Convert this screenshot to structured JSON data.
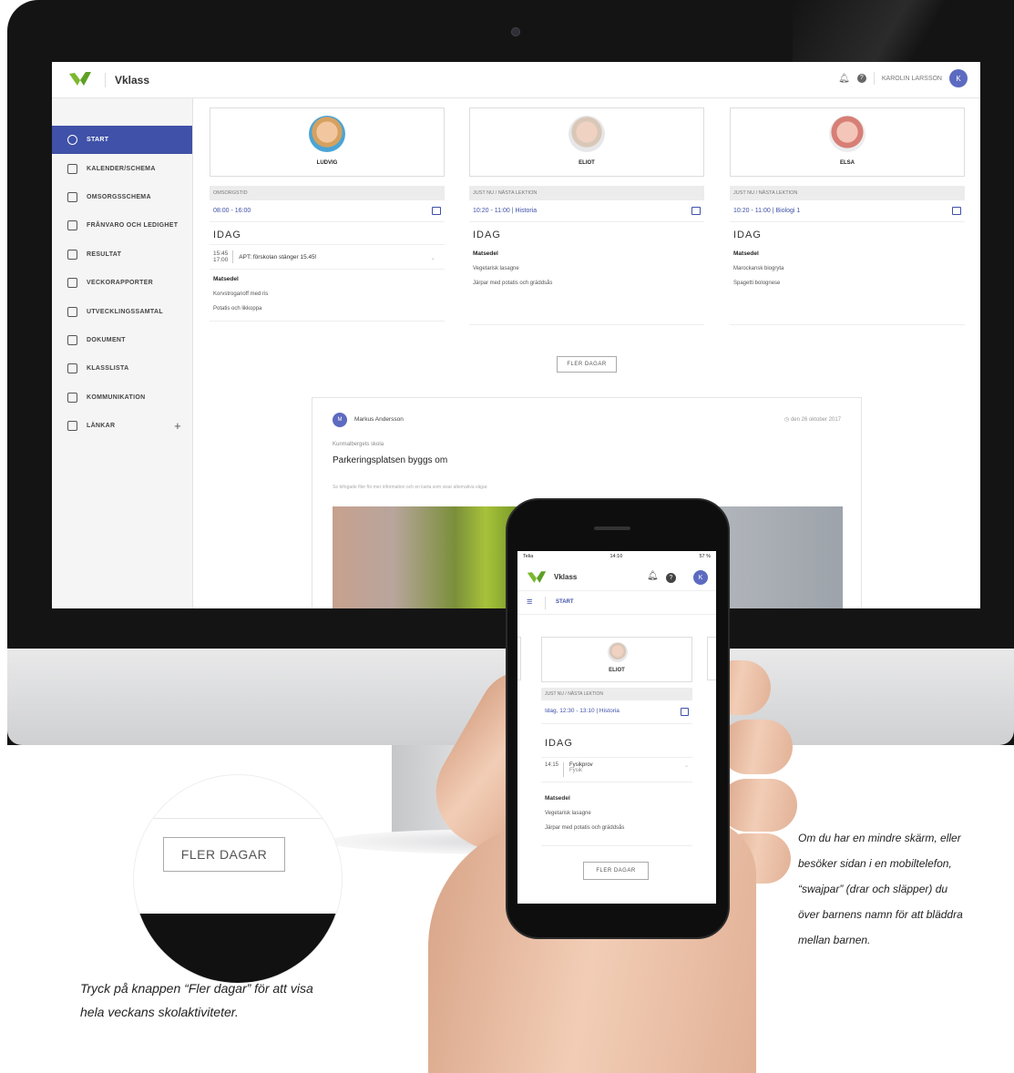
{
  "app": {
    "brand": "Vklass",
    "user_name": "KAROLIN LARSSON",
    "user_initial": "K",
    "accent": "#3f51a8"
  },
  "sidebar": {
    "items": [
      {
        "label": "START",
        "icon": "home-icon",
        "active": true
      },
      {
        "label": "KALENDER/SCHEMA",
        "icon": "calendar-icon"
      },
      {
        "label": "OMSORGSSCHEMA",
        "icon": "calendar-icon"
      },
      {
        "label": "FRÅNVARO OCH LEDIGHET",
        "icon": "calendar-icon"
      },
      {
        "label": "RESULTAT",
        "icon": "grid-icon"
      },
      {
        "label": "VECKORAPPORTER",
        "icon": "mail-icon"
      },
      {
        "label": "UTVECKLINGSSAMTAL",
        "icon": "people-icon"
      },
      {
        "label": "DOKUMENT",
        "icon": "document-icon"
      },
      {
        "label": "KLASSLISTA",
        "icon": "list-icon"
      },
      {
        "label": "KOMMUNIKATION",
        "icon": "send-icon"
      },
      {
        "label": "LÄNKAR",
        "icon": "link-icon",
        "extra": "+"
      }
    ]
  },
  "children": [
    {
      "name": "LUDVIG",
      "strip": "OMSORGSTID",
      "time": "08:00 - 16:00",
      "idag": "IDAG",
      "event_time": "15:45\n17:00",
      "event_text": "APT: förskolan stänger 15.45!",
      "menu_title": "Matsedel",
      "menu": [
        "Korvstroganoff med ris",
        "Potatis och likkoppa"
      ]
    },
    {
      "name": "ELIOT",
      "strip": "JUST NU / NÄSTA LEKTION",
      "time": "10:20 - 11:00",
      "subject": "Historia",
      "idag": "IDAG",
      "menu_title": "Matsedel",
      "menu": [
        "Vegetarisk lasagne",
        "Järpar med potatis och gräddsås"
      ]
    },
    {
      "name": "ELSA",
      "strip": "JUST NU / NÄSTA LEKTION",
      "time": "10:20 - 11:00",
      "subject": "Biologi 1",
      "idag": "IDAG",
      "menu_title": "Matsedel",
      "menu": [
        "Marockansk biogryta",
        "Spagetti bolognese"
      ]
    }
  ],
  "more_button": "FLER DAGAR",
  "post": {
    "author_initial": "M",
    "author": "Markus Andersson",
    "date": "den 26 oktober 2017",
    "source": "Kunmalbergets skola",
    "title": "Parkeringsplatsen byggs om",
    "body": "Se bifogade filer för mer information och en karta som visar alternativa vägar."
  },
  "phone": {
    "carrier": "Telia",
    "time": "14:10",
    "battery": "57 %",
    "brand": "Vklass",
    "user_initial": "K",
    "nav": "START",
    "child": "ELIOT",
    "strip": "JUST NU / NÄSTA LEKTION",
    "time_row": "Idag, 12:30 - 13:10",
    "subject": "Historia",
    "idag": "IDAG",
    "event_time": "14:15",
    "event_title": "Fysikprov",
    "event_sub": "Fysik",
    "menu_title": "Matsedel",
    "menu": [
      "Vegetarisk lasagne",
      "Järpar med potatis och gräddsås"
    ],
    "button": "FLER DAGAR"
  },
  "zoom_button": "FLER DAGAR",
  "captions": {
    "left": [
      "Tryck på knappen “Fler dagar” för att visa",
      "hela veckans skolaktiviteter."
    ],
    "right": [
      "Om du har en mindre skärm, eller",
      "besöker sidan i en mobiltelefon,",
      "“swajpar” (drar och släpper) du",
      "över barnens namn för att bläddra",
      "mellan barnen."
    ]
  }
}
